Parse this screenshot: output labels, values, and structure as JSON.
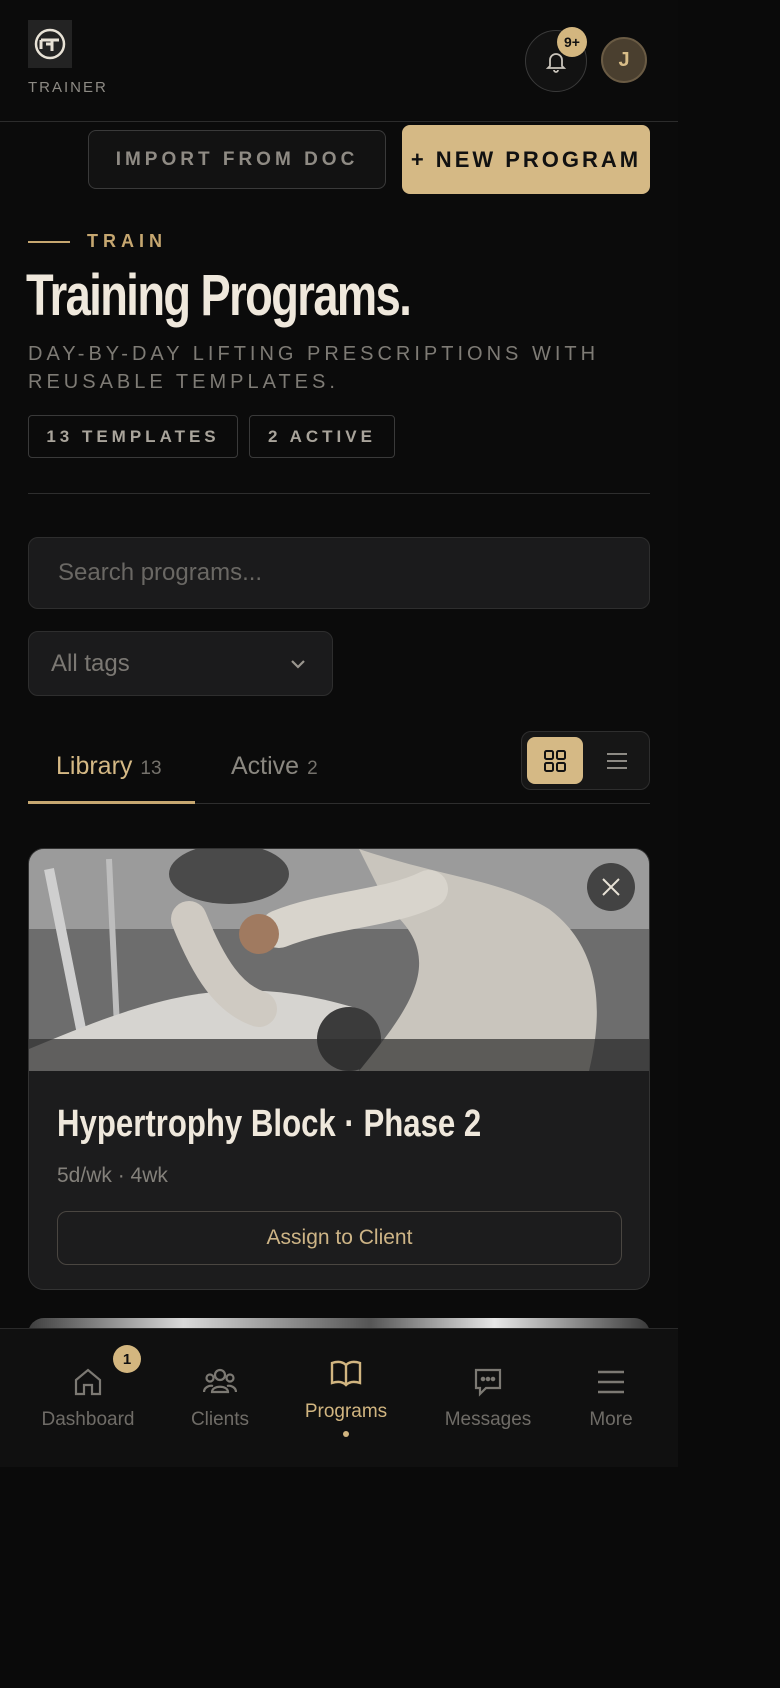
{
  "header": {
    "role": "TRAINER",
    "notifications_badge": "9+",
    "avatar_initial": "J",
    "import_label": "IMPORT FROM DOC",
    "new_program_label": "+ NEW PROGRAM",
    "logo_icon": "brand-logo-icon"
  },
  "hero": {
    "eyebrow": "TRAIN",
    "title": "Training Programs.",
    "subtitle": "DAY-BY-DAY LIFTING PRESCRIPTIONS WITH REUSABLE TEMPLATES.",
    "pills": [
      {
        "label": "13 TEMPLATES"
      },
      {
        "label": "2 ACTIVE"
      }
    ]
  },
  "filters": {
    "search_placeholder": "Search programs...",
    "tag_select": "All tags"
  },
  "tabs": [
    {
      "label": "Library",
      "count": "13",
      "active": true
    },
    {
      "label": "Active",
      "count": "2",
      "active": false
    }
  ],
  "view_toggle": {
    "selected": "grid"
  },
  "cards": [
    {
      "title": "Hypertrophy Block · Phase 2",
      "meta": "5d/wk · 4wk",
      "action": "Assign to Client"
    }
  ],
  "nav": {
    "items": [
      {
        "label": "Dashboard",
        "icon": "home-icon",
        "badge": "1"
      },
      {
        "label": "Clients",
        "icon": "users-icon"
      },
      {
        "label": "Programs",
        "icon": "book-icon",
        "active": true
      },
      {
        "label": "Messages",
        "icon": "message-icon"
      },
      {
        "label": "More",
        "icon": "menu-icon"
      }
    ]
  },
  "colors": {
    "accent": "#d5b985",
    "background": "#0b0b0b",
    "surface": "#1c1c1d"
  }
}
